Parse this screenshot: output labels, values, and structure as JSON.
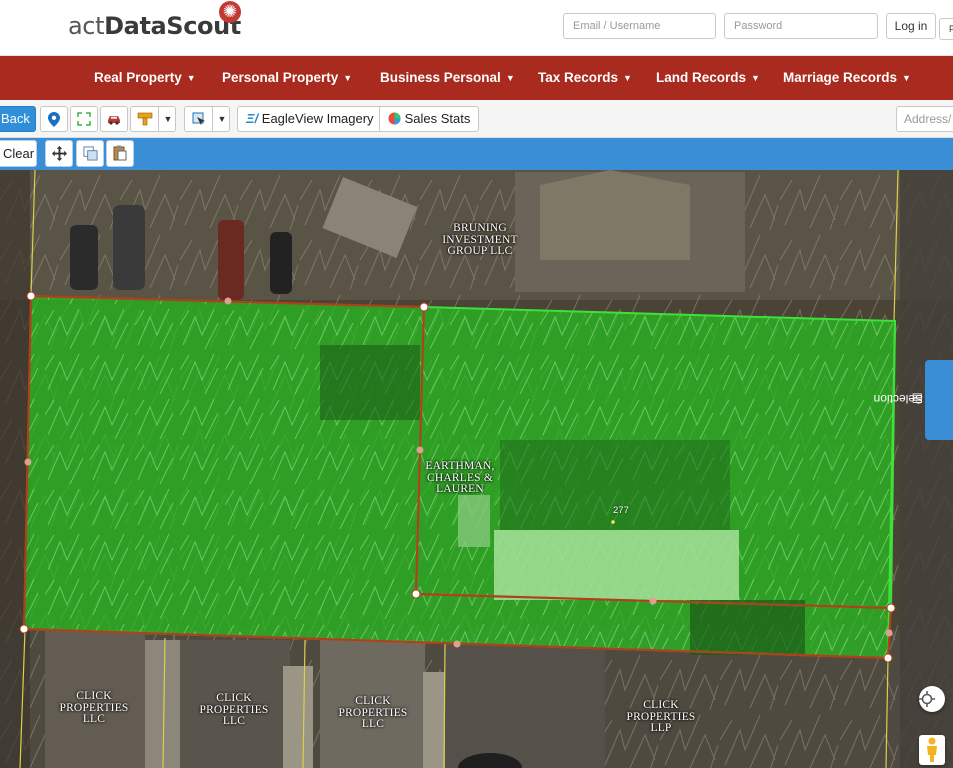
{
  "app": {
    "logo_light": "act",
    "logo_bold": "DataScout",
    "logo_mark": "✺"
  },
  "login": {
    "email_placeholder": "Email / Username",
    "password_placeholder": "Password",
    "login_label": "Log in",
    "extra_button_cut": "P"
  },
  "nav": {
    "items": [
      {
        "label": "Real Property"
      },
      {
        "label": "Personal Property"
      },
      {
        "label": "Business Personal"
      },
      {
        "label": "Tax Records"
      },
      {
        "label": "Land Records"
      },
      {
        "label": "Marriage Records"
      }
    ]
  },
  "toolbar": {
    "back_label": "Back",
    "eagleview_label": "EagleView Imagery",
    "sales_stats_label": "Sales Stats",
    "address_placeholder": "Address/"
  },
  "secondary_toolbar": {
    "clear_label": "Clear"
  },
  "map": {
    "owners": [
      {
        "name": "BRUNING\nINVESTMENT\nGROUP LLC"
      },
      {
        "name": "EARTHMAN,\nCHARLES &\nLAUREN"
      },
      {
        "name": "CLICK\nPROPERTIES\nLLC"
      },
      {
        "name": "CLICK\nPROPERTIES\nLLC"
      },
      {
        "name": "CLICK\nPROPERTIES\nLLC"
      },
      {
        "name": "CLICK\nPROPERTIES\nLLP"
      }
    ],
    "parcel_number": "277",
    "selection_tab_label": "Selection",
    "colors": {
      "selection_fill": "#22c01e",
      "selection_outline": "#b0401c",
      "parcel_outline": "#3ee03a",
      "lot_lines": "#d9d14a"
    }
  },
  "colors": {
    "nav_bg": "#a92a1f",
    "secondary_bar_bg": "#3a8ed6",
    "back_button_bg": "#2f8fd8"
  },
  "icons": {
    "map_pin": "map-marker-icon",
    "full_extent": "expand-icon",
    "car": "car-icon",
    "measure": "ruler-icon",
    "identify": "identify-icon",
    "eagleview": "eagleview-icon",
    "sales_stats": "pie-chart-icon",
    "pan": "pan-icon",
    "copy": "copy-icon",
    "paste": "paste-icon",
    "selection": "selection-icon",
    "locate": "locate-icon",
    "streetview": "pegman-icon"
  }
}
